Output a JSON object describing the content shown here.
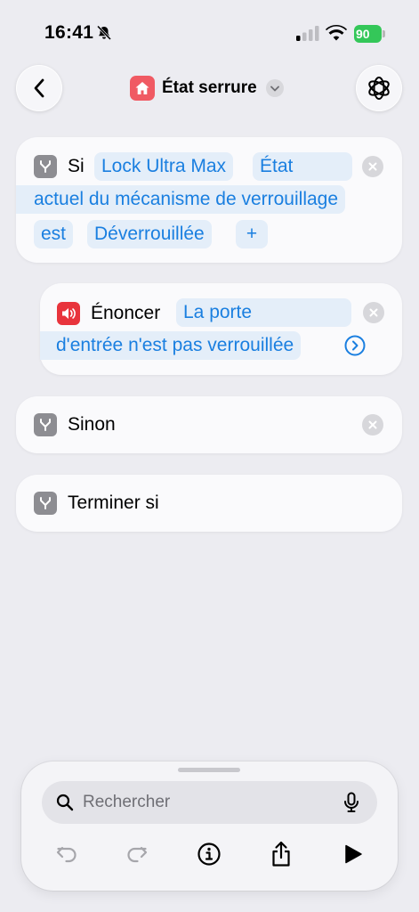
{
  "status_bar": {
    "time": "16:41",
    "battery": "90"
  },
  "nav": {
    "title": "État serrure"
  },
  "actions": {
    "if": {
      "keyword": "Si",
      "device": "Lock Ultra Max",
      "state_part1": "État",
      "state_part2": "actuel du mécanisme de verrouillage",
      "operator": "est",
      "value": "Déverrouillée",
      "add": "+"
    },
    "speak": {
      "keyword": "Énoncer",
      "text_part1": "La porte",
      "text_part2": "d'entrée n'est pas verrouillée"
    },
    "else": {
      "keyword": "Sinon"
    },
    "end_if": {
      "keyword": "Terminer si"
    }
  },
  "bottom": {
    "search_placeholder": "Rechercher"
  },
  "colors": {
    "accent": "#1a7fe0",
    "token_bg": "#e4eef9",
    "battery": "#34c759",
    "speak_icon": "#e8343c",
    "home_icon": "#f05a63"
  }
}
